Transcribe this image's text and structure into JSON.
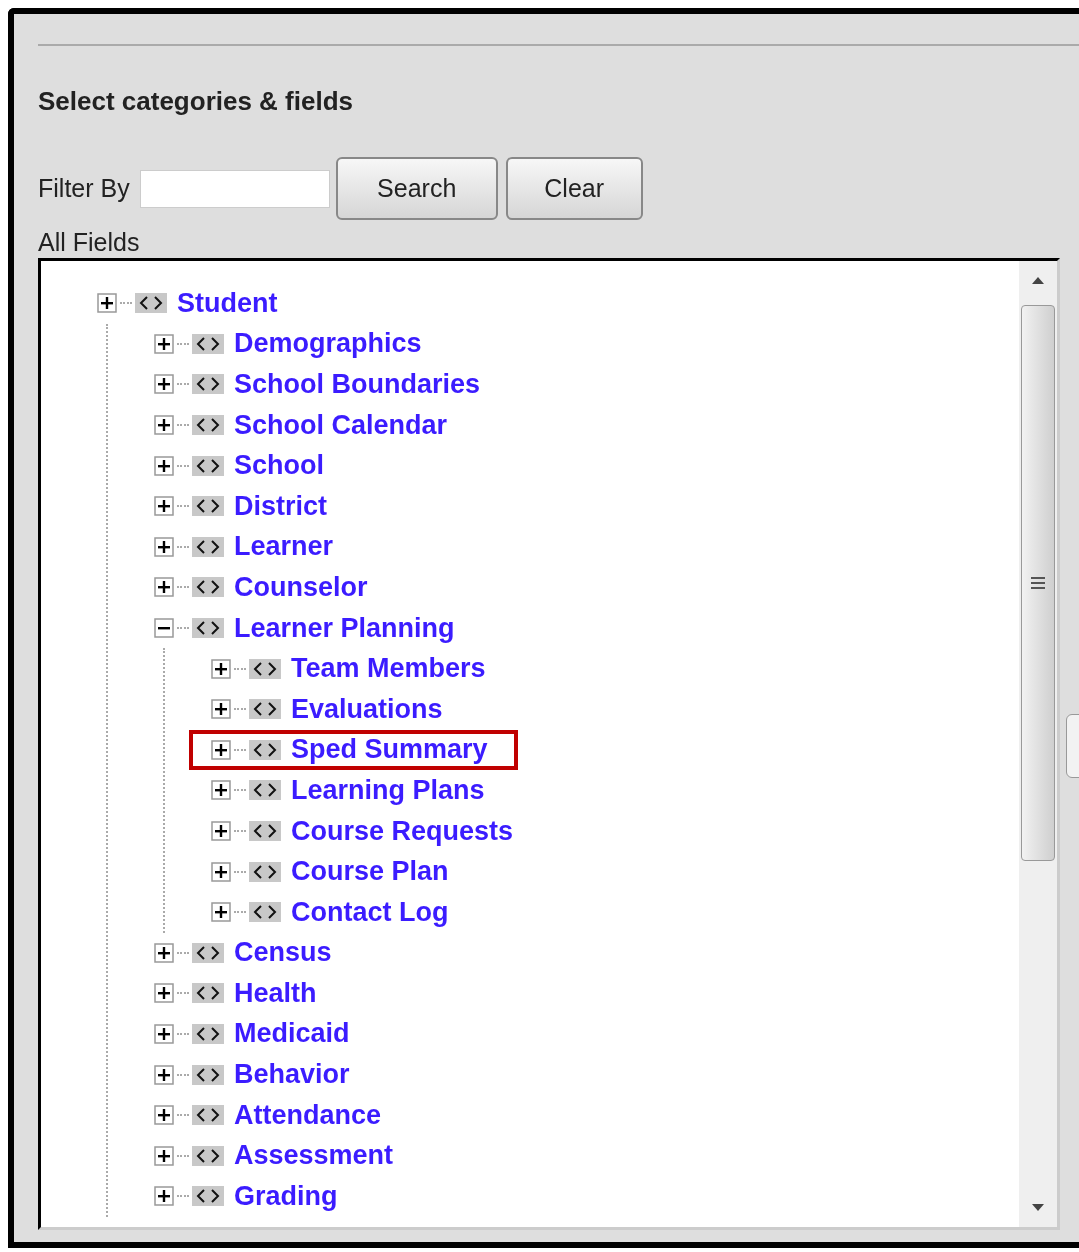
{
  "heading": "Select categories & fields",
  "filter": {
    "label": "Filter By"
  },
  "buttons": [
    "Search",
    "Clear"
  ],
  "tree_label": "All Fields",
  "tree": [
    {
      "label": "Student",
      "expanded": false,
      "highlighted": false,
      "children": [
        {
          "label": "Demographics",
          "expanded": false,
          "highlighted": false
        },
        {
          "label": "School Boundaries",
          "expanded": false,
          "highlighted": false
        },
        {
          "label": "School Calendar",
          "expanded": false,
          "highlighted": false
        },
        {
          "label": "School",
          "expanded": false,
          "highlighted": false
        },
        {
          "label": "District",
          "expanded": false,
          "highlighted": false
        },
        {
          "label": "Learner",
          "expanded": false,
          "highlighted": false
        },
        {
          "label": "Counselor",
          "expanded": false,
          "highlighted": false
        },
        {
          "label": "Learner Planning",
          "expanded": true,
          "highlighted": false,
          "children": [
            {
              "label": "Team Members",
              "expanded": false,
              "highlighted": false
            },
            {
              "label": "Evaluations",
              "expanded": false,
              "highlighted": false
            },
            {
              "label": "Sped Summary",
              "expanded": false,
              "highlighted": true
            },
            {
              "label": "Learning Plans",
              "expanded": false,
              "highlighted": false
            },
            {
              "label": "Course Requests",
              "expanded": false,
              "highlighted": false
            },
            {
              "label": "Course Plan",
              "expanded": false,
              "highlighted": false
            },
            {
              "label": "Contact Log",
              "expanded": false,
              "highlighted": false
            }
          ]
        },
        {
          "label": "Census",
          "expanded": false,
          "highlighted": false
        },
        {
          "label": "Health",
          "expanded": false,
          "highlighted": false
        },
        {
          "label": "Medicaid",
          "expanded": false,
          "highlighted": false
        },
        {
          "label": "Behavior",
          "expanded": false,
          "highlighted": false
        },
        {
          "label": "Attendance",
          "expanded": false,
          "highlighted": false
        },
        {
          "label": "Assessment",
          "expanded": false,
          "highlighted": false
        },
        {
          "label": "Grading",
          "expanded": false,
          "highlighted": false
        }
      ]
    }
  ]
}
